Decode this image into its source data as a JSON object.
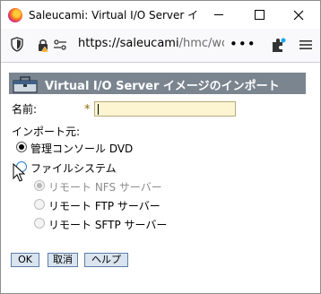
{
  "window": {
    "title": "Saleucami: Virtual I/O Server イメ...",
    "minimize_label": "–",
    "maximize_label": "□",
    "close_label": "✕"
  },
  "browser": {
    "url_host": "https://saleucami",
    "url_path": "/hmc/wcl/",
    "more_label": "•••"
  },
  "dialog": {
    "title": "Virtual I/O Server イメージのインポート",
    "name_label": "名前:",
    "required_marker": "*",
    "name_value": "",
    "import_source_label": "インポート元:",
    "options": [
      {
        "label": "管理コンソール DVD",
        "checked": true,
        "enabled": true
      },
      {
        "label": "ファイルシステム",
        "checked": false,
        "enabled": true
      }
    ],
    "sub_options": [
      {
        "label": "リモート NFS サーバー",
        "checked": true,
        "enabled": false
      },
      {
        "label": "リモート FTP サーバー",
        "checked": false,
        "enabled": false
      },
      {
        "label": "リモート SFTP サーバー",
        "checked": false,
        "enabled": false
      }
    ],
    "buttons": {
      "ok": "OK",
      "cancel": "取消",
      "help": "ヘルプ"
    }
  },
  "colors": {
    "header_band": "#7a8590",
    "input_bg": "#fdf5d2",
    "button_bg": "#d9e4ef",
    "button_border": "#5c7ea6"
  }
}
